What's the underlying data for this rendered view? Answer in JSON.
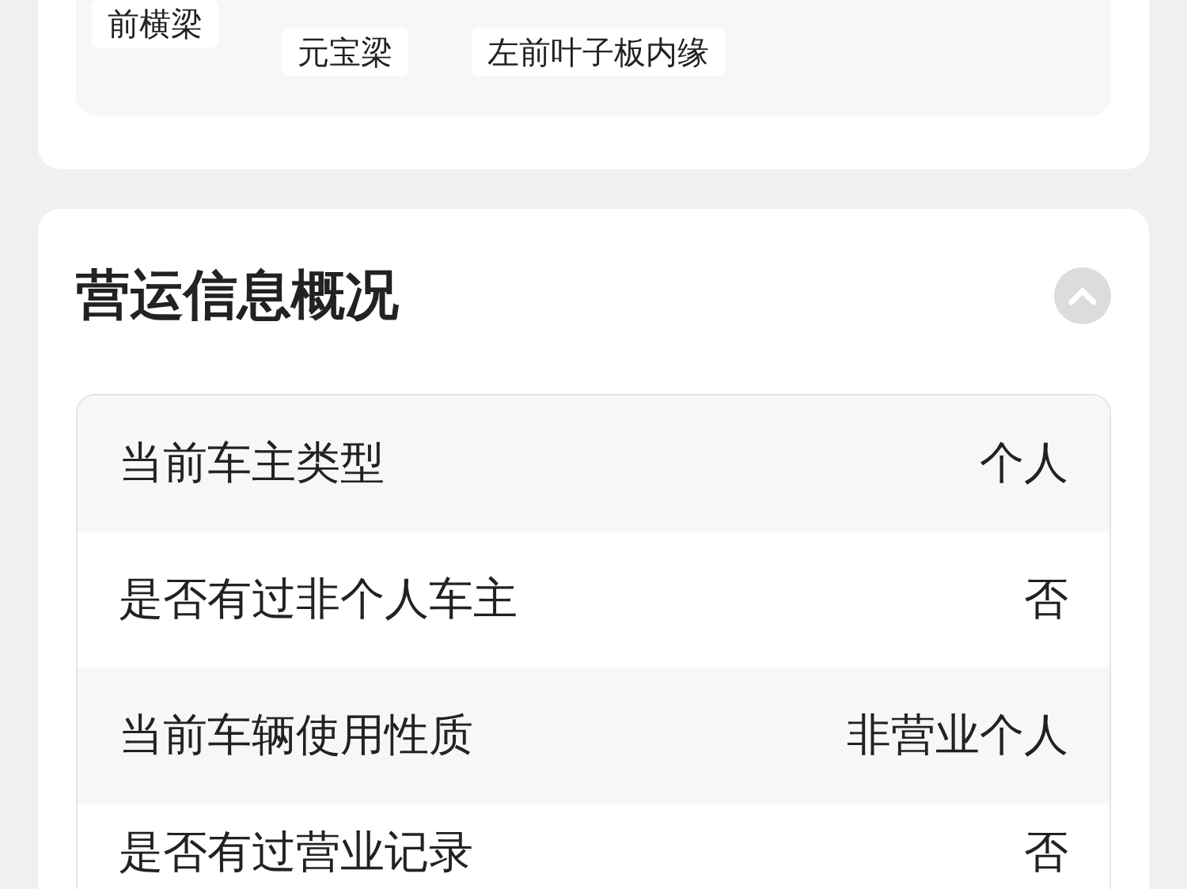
{
  "parts_section": {
    "chips": [
      "前横梁",
      "元宝梁",
      "左前叶子板内缘"
    ]
  },
  "operation_section": {
    "title": "营运信息概况",
    "expanded": true,
    "rows": [
      {
        "label": "当前车主类型",
        "value": "个人"
      },
      {
        "label": "是否有过非个人车主",
        "value": "否"
      },
      {
        "label": "当前车辆使用性质",
        "value": "非营业个人"
      },
      {
        "label": "是否有过营业记录",
        "value": "否"
      }
    ]
  }
}
